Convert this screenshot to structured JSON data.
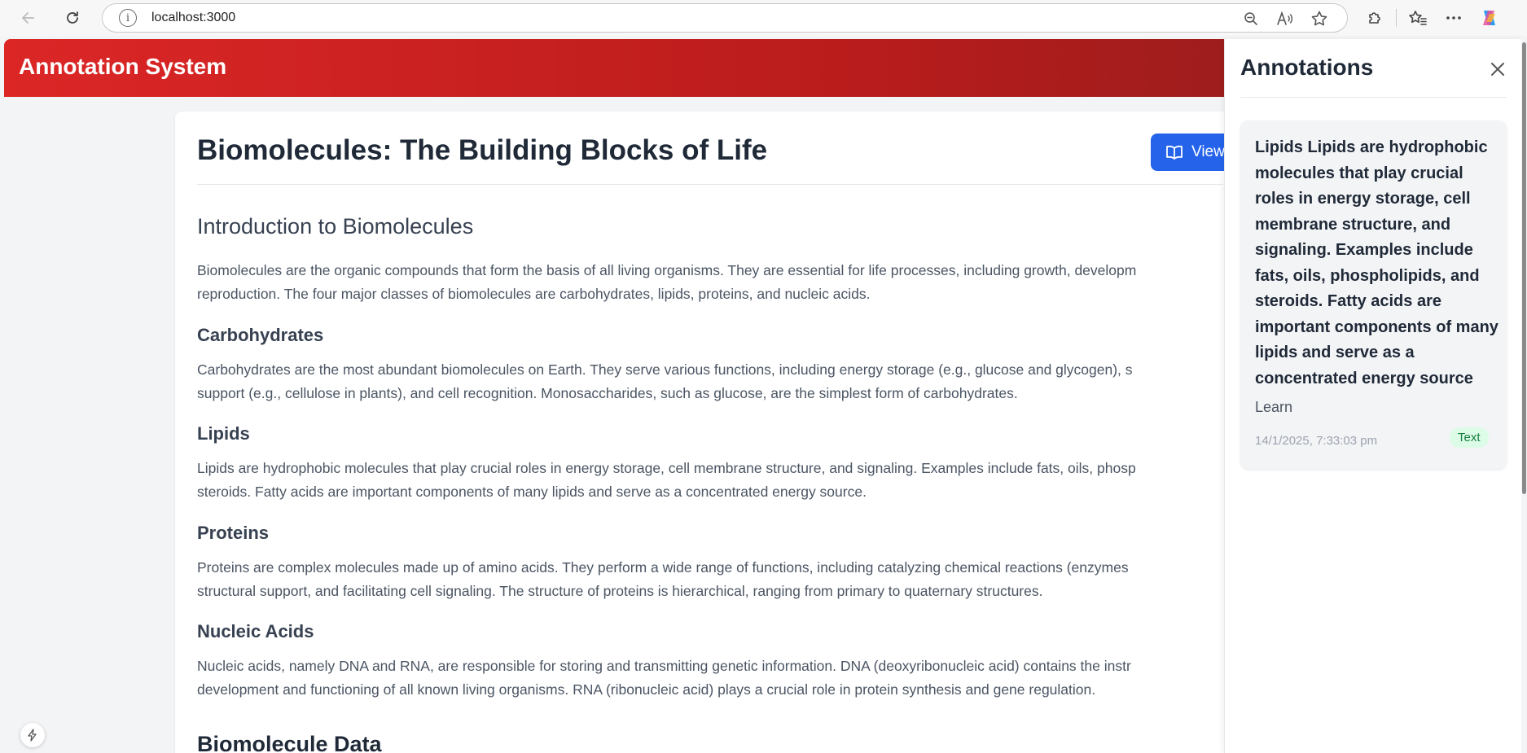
{
  "browser": {
    "url": "localhost:3000"
  },
  "app": {
    "title": "Annotation System"
  },
  "document": {
    "title": "Biomolecules: The Building Blocks of Life",
    "view_button_label": "View",
    "sections": [
      {
        "heading": "Introduction to Biomolecules",
        "lines": [
          "Biomolecules are the organic compounds that form the basis of all living organisms. They are essential for life processes, including growth, developm",
          "reproduction. The four major classes of biomolecules are carbohydrates, lipids, proteins, and nucleic acids."
        ]
      },
      {
        "heading": "Carbohydrates",
        "lines": [
          "Carbohydrates are the most abundant biomolecules on Earth. They serve various functions, including energy storage (e.g., glucose and glycogen), s",
          "support (e.g., cellulose in plants), and cell recognition. Monosaccharides, such as glucose, are the simplest form of carbohydrates."
        ]
      },
      {
        "heading": "Lipids",
        "lines": [
          "Lipids are hydrophobic molecules that play crucial roles in energy storage, cell membrane structure, and signaling. Examples include fats, oils, phosp",
          "steroids. Fatty acids are important components of many lipids and serve as a concentrated energy source."
        ]
      },
      {
        "heading": "Proteins",
        "lines": [
          "Proteins are complex molecules made up of amino acids. They perform a wide range of functions, including catalyzing chemical reactions (enzymes",
          "structural support, and facilitating cell signaling. The structure of proteins is hierarchical, ranging from primary to quaternary structures."
        ]
      },
      {
        "heading": "Nucleic Acids",
        "lines": [
          "Nucleic acids, namely DNA and RNA, are responsible for storing and transmitting genetic information. DNA (deoxyribonucleic acid) contains the instr",
          "development and functioning of all known living organisms. RNA (ribonucleic acid) plays a crucial role in protein synthesis and gene regulation."
        ]
      }
    ],
    "data_heading": "Biomolecule Data"
  },
  "panel": {
    "title": "Annotations",
    "annotations": [
      {
        "text": "Lipids Lipids are hydrophobic molecules that play crucial roles in energy storage, cell membrane structure, and signaling. Examples include fats, oils, phospholipids, and steroids. Fatty acids are important components of many lipids and serve as a concentrated energy source",
        "note": "Learn",
        "timestamp": "14/1/2025, 7:33:03 pm",
        "type": "Text"
      }
    ]
  },
  "colors": {
    "header_red": "#dc2626",
    "view_button_blue": "#2563eb",
    "badge_green_bg": "#dcfce7",
    "badge_green_text": "#15803d"
  },
  "icons": {
    "back": "arrow-left-icon",
    "reload": "reload-icon",
    "info": "info-icon",
    "zoom": "zoom-out-icon",
    "read_aloud": "read-aloud-icon",
    "favorite": "star-icon",
    "extensions": "puzzle-icon",
    "favorites_bar": "favorites-icon",
    "more": "more-icon",
    "copilot": "copilot-icon",
    "book": "book-open-icon",
    "close": "close-icon",
    "bolt": "bolt-icon"
  }
}
